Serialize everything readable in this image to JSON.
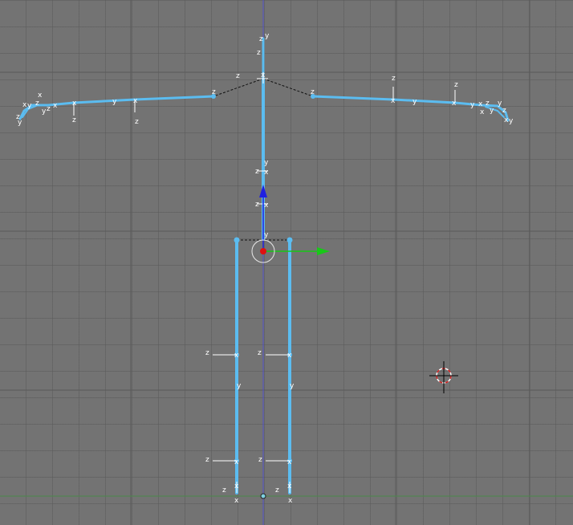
{
  "viewport": {
    "view": "front-orthographic",
    "object": "armature",
    "mode": "pose"
  },
  "colors": {
    "background": "#737373",
    "grid": "#5a5a5a",
    "bone": "#5bbcf0",
    "vertical_axis": "#5050c8",
    "horizontal_axis": "#4a8a4a",
    "manipulator_z": "#2020e0",
    "manipulator_x": "#18c818",
    "pivot": "#e01010",
    "cursor_ring": "#d02020"
  },
  "axis_glyphs": {
    "x": "x",
    "y": "y",
    "z": "z"
  }
}
